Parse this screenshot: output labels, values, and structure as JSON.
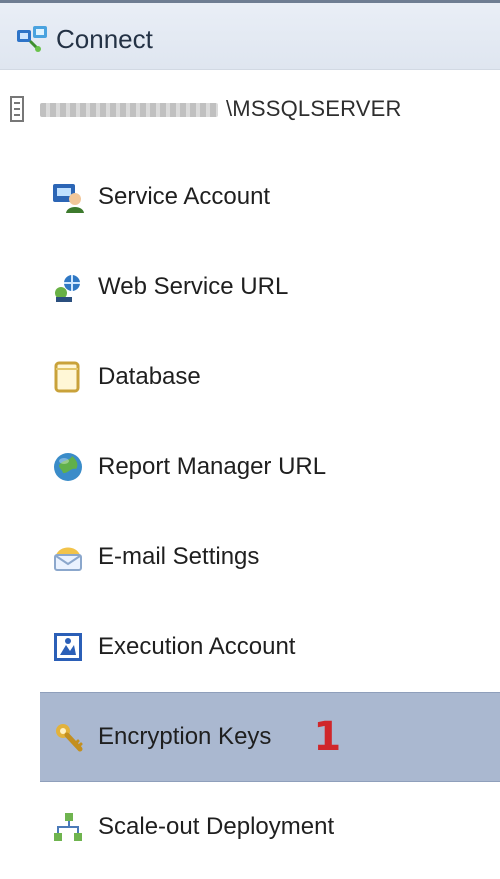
{
  "header": {
    "connect_label": "Connect",
    "connect_icon": "connect-icon"
  },
  "server": {
    "instance_suffix": "\\MSSQLSERVER",
    "icon": "server-tree-icon"
  },
  "nav": {
    "items": [
      {
        "label": "Service Account",
        "icon": "service-account-icon"
      },
      {
        "label": "Web Service URL",
        "icon": "web-service-url-icon"
      },
      {
        "label": "Database",
        "icon": "database-icon"
      },
      {
        "label": "Report Manager URL",
        "icon": "globe-icon"
      },
      {
        "label": "E-mail Settings",
        "icon": "email-settings-icon"
      },
      {
        "label": "Execution Account",
        "icon": "execution-account-icon"
      },
      {
        "label": "Encryption Keys",
        "icon": "encryption-keys-icon",
        "selected": true,
        "annotation": "1"
      },
      {
        "label": "Scale-out Deployment",
        "icon": "scale-out-icon"
      }
    ]
  },
  "colors": {
    "selection": "#aab8d0",
    "annotation": "#d0262a",
    "toolbar_top": "#6e7d92"
  }
}
